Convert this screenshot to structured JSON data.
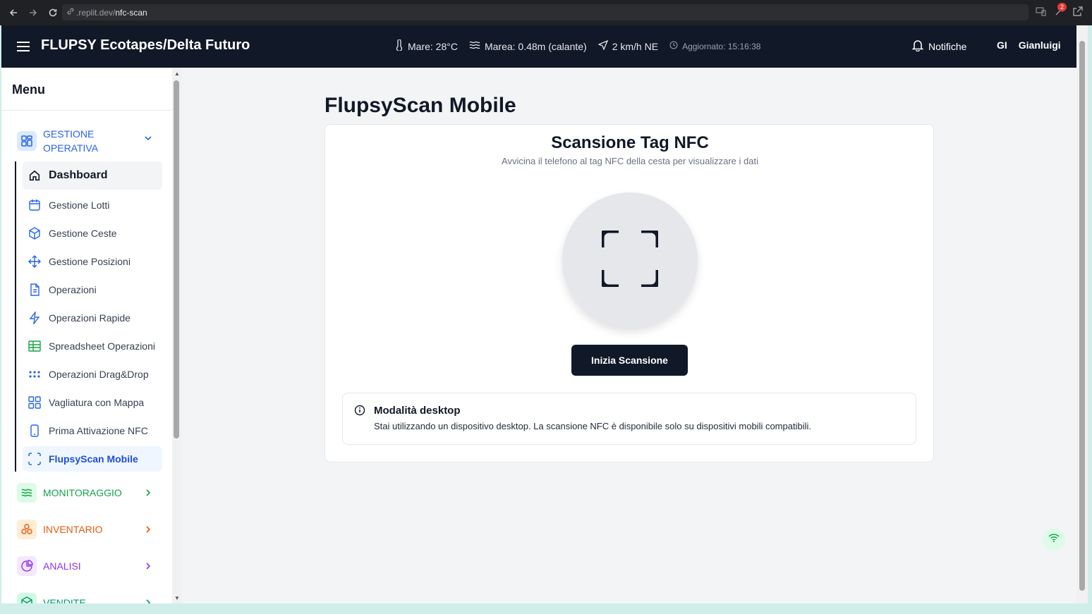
{
  "browser": {
    "url_host": ".replit.dev/",
    "url_path": "nfc-scan",
    "badge_count": "2"
  },
  "topbar": {
    "title": "FLUPSY Ecotapes/Delta Futuro",
    "sea_temp": "Mare: 28°C",
    "tide": "Marea: 0.48m (calante)",
    "wind": "2 km/h NE",
    "updated": "Aggiornato: 15:16:38",
    "notifications": "Notifiche",
    "user_initials": "GI",
    "user_name": "Gianluigi"
  },
  "sidebar": {
    "heading": "Menu",
    "groups": [
      {
        "label": "GESTIONE OPERATIVA",
        "color": "#2563eb"
      },
      {
        "label": "MONITORAGGIO",
        "color": "#16a34a"
      },
      {
        "label": "INVENTARIO",
        "color": "#ea580c"
      },
      {
        "label": "ANALISI",
        "color": "#9333ea"
      },
      {
        "label": "VENDITE",
        "color": "#059669"
      }
    ],
    "items": [
      {
        "label": "Dashboard",
        "icon": "home-icon"
      },
      {
        "label": "Gestione Lotti",
        "icon": "calendar-icon"
      },
      {
        "label": "Gestione Ceste",
        "icon": "box-icon"
      },
      {
        "label": "Gestione Posizioni",
        "icon": "move-icon"
      },
      {
        "label": "Operazioni",
        "icon": "file-text-icon"
      },
      {
        "label": "Operazioni Rapide",
        "icon": "lightning-icon"
      },
      {
        "label": "Spreadsheet Operazioni",
        "icon": "table-icon"
      },
      {
        "label": "Operazioni Drag&Drop",
        "icon": "grip-icon"
      },
      {
        "label": "Vagliatura con Mappa",
        "icon": "grid-icon"
      },
      {
        "label": "Prima Attivazione NFC",
        "icon": "smartphone-icon"
      },
      {
        "label": "FlupsyScan Mobile",
        "icon": "scan-icon"
      }
    ]
  },
  "main": {
    "page_title": "FlupsyScan Mobile",
    "card_title": "Scansione Tag NFC",
    "card_subtitle": "Avvicina il telefono al tag NFC della cesta per visualizzare i dati",
    "scan_button": "Inizia Scansione",
    "alert_title": "Modalità desktop",
    "alert_text": "Stai utilizzando un dispositivo desktop. La scansione NFC è disponibile solo su dispositivi mobili compatibili."
  }
}
